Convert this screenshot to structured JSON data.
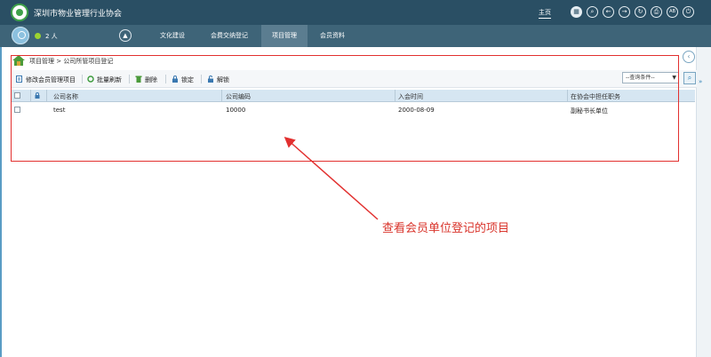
{
  "header": {
    "site_title": "深圳市物业管理行业协会",
    "home_label": "主页"
  },
  "navbar": {
    "online_count": "2 人",
    "tabs": [
      {
        "label": "文化建设",
        "active": false
      },
      {
        "label": "会费交纳登记",
        "active": false
      },
      {
        "label": "项目管理",
        "active": true
      },
      {
        "label": "会员资料",
        "active": false
      }
    ]
  },
  "breadcrumb": "项目管理 > 公司所管项目登记",
  "toolbar": {
    "edit_label": "修改会员管理项目",
    "refresh_label": "批量刷新",
    "delete_label": "删除",
    "lock_label": "锁定",
    "unlock_label": "解锁",
    "query_select_value": "--查询条件--"
  },
  "table": {
    "headers": [
      "公司名称",
      "公司编码",
      "入会时间",
      "在协会中担任职务"
    ],
    "rows": [
      {
        "name": "test",
        "code": "10000",
        "join_date": "2000-08-09",
        "role": "副秘书长单位"
      }
    ]
  },
  "annotation": {
    "text": "查看会员单位登记的项目",
    "color": "#d9342b"
  },
  "colors": {
    "header_bg": "#2a4f64",
    "nav_bg": "#3e6478",
    "table_header_bg": "#d6e6f2",
    "annotation_red": "#e2302f"
  }
}
